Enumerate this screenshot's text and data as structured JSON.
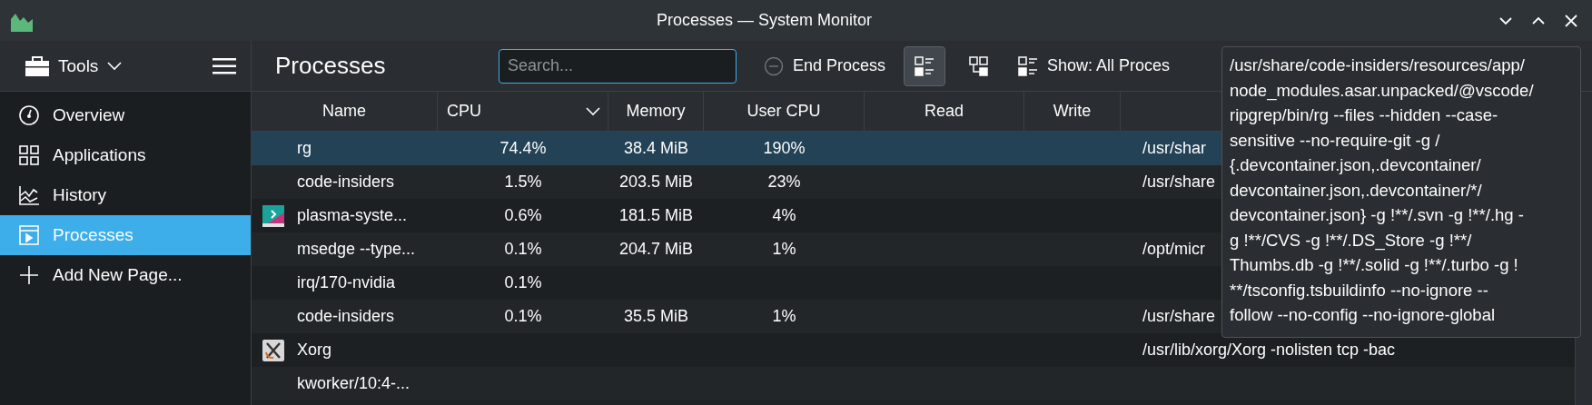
{
  "window": {
    "title": "Processes — System Monitor"
  },
  "sidebar": {
    "tools_label": "Tools",
    "items": [
      {
        "label": "Overview",
        "kind": "gauge",
        "selected": false
      },
      {
        "label": "Applications",
        "kind": "grid",
        "selected": false
      },
      {
        "label": "History",
        "kind": "chart",
        "selected": false
      },
      {
        "label": "Processes",
        "kind": "window",
        "selected": true
      },
      {
        "label": "Add New Page...",
        "kind": "plus",
        "selected": false
      }
    ]
  },
  "toolbar": {
    "title": "Processes",
    "search": {
      "placeholder": "Search..."
    },
    "end_process": "End Process",
    "view_buttons": [
      {
        "kind": "list",
        "selected": true
      },
      {
        "kind": "tree",
        "selected": false
      }
    ],
    "show": "Show: All Proces"
  },
  "table": {
    "columns": [
      {
        "label": "Name",
        "sorted": false
      },
      {
        "label": "CPU",
        "sorted": true
      },
      {
        "label": "Memory",
        "sorted": false
      },
      {
        "label": "User CPU",
        "sorted": false
      },
      {
        "label": "Read",
        "sorted": false
      },
      {
        "label": "Write",
        "sorted": false
      }
    ],
    "rows": [
      {
        "kind": "plain",
        "name": "rg",
        "cpu": "74.4%",
        "memory": "38.4 MiB",
        "user_cpu": "190%",
        "command": "/usr/shar",
        "selected": true
      },
      {
        "kind": "plain",
        "name": "code-insiders",
        "cpu": "1.5%",
        "memory": "203.5 MiB",
        "user_cpu": "23%",
        "command": "/usr/share",
        "selected": false
      },
      {
        "kind": "monitor-app",
        "name": "plasma-syste...",
        "cpu": "0.6%",
        "memory": "181.5 MiB",
        "user_cpu": "4%",
        "selected": false
      },
      {
        "kind": "plain",
        "name": "msedge --type...",
        "cpu": "0.1%",
        "memory": "204.7 MiB",
        "user_cpu": "1%",
        "command": "/opt/micr",
        "selected": false
      },
      {
        "kind": "plain",
        "name": "irq/170-nvidia",
        "cpu": "0.1%",
        "selected": false
      },
      {
        "kind": "plain",
        "name": "code-insiders",
        "cpu": "0.1%",
        "memory": "35.5 MiB",
        "user_cpu": "1%",
        "command": "/usr/share",
        "selected": false
      },
      {
        "kind": "x-app",
        "name": "Xorg",
        "command": "/usr/lib/xorg/Xorg -nolisten tcp -bac",
        "selected": false
      },
      {
        "kind": "plain",
        "name": "kworker/10:4-...",
        "selected": false
      }
    ]
  },
  "tooltip": {
    "lines": [
      "/usr/share/code-insiders/resources/app/",
      "node_modules.asar.unpacked/@vscode/",
      "ripgrep/bin/rg --files --hidden --case-",
      "sensitive --no-require-git -g /",
      "{.devcontainer.json,.devcontainer/",
      "devcontainer.json,.devcontainer/*/",
      "devcontainer.json} -g !**/.svn -g !**/.hg -",
      "g !**/CVS -g !**/.DS_Store -g !**/",
      "Thumbs.db -g !**/.solid -g !**/.turbo -g !",
      "**/tsconfig.tsbuildinfo --no-ignore --",
      "follow --no-config --no-ignore-global"
    ]
  }
}
